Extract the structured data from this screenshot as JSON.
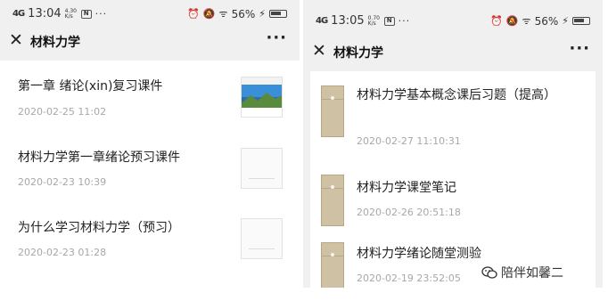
{
  "left": {
    "status": {
      "signal": "4G",
      "time": "13:04",
      "speed": "4.30 K/s",
      "app_badge": "N",
      "battery": "56%"
    },
    "title": "材料力学",
    "items": [
      {
        "title": "第一章 绪论(xin)复习课件",
        "date": "2020-02-25 11:02"
      },
      {
        "title": "材料力学第一章绪论预习课件",
        "date": "2020-02-23 10:39"
      },
      {
        "title": "为什么学习材料力学（预习）",
        "date": "2020-02-23 01:28"
      }
    ]
  },
  "right": {
    "status": {
      "signal": "4G",
      "time": "13:05",
      "speed": "0.70 K/s",
      "app_badge": "N",
      "battery": "56%"
    },
    "title": "材料力学",
    "items": [
      {
        "title": "材料力学基本概念课后习题（提高）",
        "date": "2020-02-27 11:10:31"
      },
      {
        "title": "材料力学课堂笔记",
        "date": "2020-02-26 20:51:18"
      },
      {
        "title": "材料力学绪论随堂测验",
        "date": "2020-02-19 23:52:05"
      }
    ]
  },
  "watermark": "陪伴如馨二",
  "icons": {
    "close": "close-icon",
    "more": "more-icon",
    "file": "file-icon",
    "wechat": "wechat-icon"
  }
}
